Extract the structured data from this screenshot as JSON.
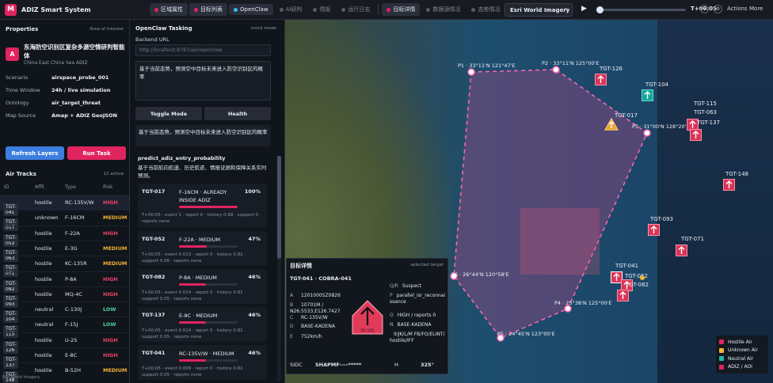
{
  "app": {
    "logo": "M",
    "title": "ADIZ Smart System"
  },
  "tabs": [
    {
      "label": "区域属性",
      "active": true
    },
    {
      "label": "目标列表",
      "active": true
    },
    {
      "label": "OpenClaw",
      "active": true
    },
    {
      "label": "AI研判",
      "active": false
    },
    {
      "label": "情报",
      "active": false
    },
    {
      "label": "运行日志",
      "active": false
    },
    {
      "label": "目标详情",
      "active": true
    },
    {
      "label": "数据源情况",
      "active": false
    },
    {
      "label": "态势情况",
      "active": false
    }
  ],
  "toolbar": {
    "imagery": "Esri World Imagery",
    "time": "T+00:05",
    "actions": "Actions",
    "more": "More",
    "progress": 0.03
  },
  "properties": {
    "title": "Properties",
    "subtitle": "Area of Interest",
    "zone_badge": "A",
    "zone_title": "东海防空识别区复杂多源空情研判智能体",
    "zone_subtitle": "China East China Sea ADIZ",
    "rows": [
      {
        "key": "Scenario",
        "value": "airspace_probe_001"
      },
      {
        "key": "Time Window",
        "value": "24h / live simulation"
      },
      {
        "key": "Ontology",
        "value": "air_target_threat"
      },
      {
        "key": "Map Source",
        "value": "Amap + ADIZ GeoJSON"
      }
    ],
    "refresh_label": "Refresh Layers",
    "run_label": "Run Task"
  },
  "tracks": {
    "title": "Air Tracks",
    "count": "12 active",
    "headers": [
      "ID",
      "Affil.",
      "Type",
      "Risk"
    ],
    "rows": [
      {
        "id": "TGT-041",
        "affil": "hostile",
        "type": "RC-135V/W",
        "risk": "HIGH"
      },
      {
        "id": "TGT-017",
        "affil": "unknown",
        "type": "F-16CM",
        "risk": "MEDIUM"
      },
      {
        "id": "TGT-052",
        "affil": "hostile",
        "type": "F-22A",
        "risk": "HIGH"
      },
      {
        "id": "TGT-063",
        "affil": "hostile",
        "type": "E-3G",
        "risk": "MEDIUM"
      },
      {
        "id": "TGT-071",
        "affil": "hostile",
        "type": "KC-135R",
        "risk": "MEDIUM"
      },
      {
        "id": "TGT-082",
        "affil": "hostile",
        "type": "P-8A",
        "risk": "HIGH"
      },
      {
        "id": "TGT-093",
        "affil": "hostile",
        "type": "MQ-4C",
        "risk": "HIGH"
      },
      {
        "id": "TGT-104",
        "affil": "neutral",
        "type": "C-130J",
        "risk": "LOW"
      },
      {
        "id": "TGT-115",
        "affil": "neutral",
        "type": "F-15J",
        "risk": "LOW"
      },
      {
        "id": "TGT-126",
        "affil": "hostile",
        "type": "U-2S",
        "risk": "HIGH"
      },
      {
        "id": "TGT-137",
        "affil": "hostile",
        "type": "E-8C",
        "risk": "HIGH"
      },
      {
        "id": "TGT-148",
        "affil": "hostile",
        "type": "B-52H",
        "risk": "MEDIUM"
      }
    ]
  },
  "tasking": {
    "title": "OpenClaw Tasking",
    "mode": "mock mode",
    "backend_label": "Backend URL",
    "backend_placeholder": "http://localhost:8787/api/openclaw",
    "prompt": "基于当前态势，预测空中目标未来进入防空识别区的概率",
    "toggle_label": "Toggle Mode",
    "health_label": "Health",
    "echo": "基于当前态势，预测空中目标未来进入防空识别区的概率",
    "task_name": "predict_adiz_entry_probability",
    "task_desc": "基于当前航向航速、历史航迹、情报证据和保障关系实时预测。",
    "cards": [
      {
        "id": "TGT-017",
        "desc": "F-16CM · ALREADY INSIDE ADIZ",
        "pct": "100%",
        "value": 1.0,
        "meta": "T+00:05 · event 1 · report 0 · history 0.68 · support 0 · reports none"
      },
      {
        "id": "TGT-052",
        "desc": "F-22A · MEDIUM",
        "pct": "47%",
        "value": 0.47,
        "meta": "T+00:05 · event 0.013 · report 0 · history 0.82 · support 0.06 · reports none"
      },
      {
        "id": "TGT-082",
        "desc": "P-8A · MEDIUM",
        "pct": "46%",
        "value": 0.46,
        "meta": "T+00:05 · event 0.014 · report 0 · history 0.82 · support 0.05 · reports none"
      },
      {
        "id": "TGT-137",
        "desc": "E-8C · MEDIUM",
        "pct": "46%",
        "value": 0.46,
        "meta": "T+00:05 · event 0.014 · report 0 · history 0.82 · support 0.05 · reports none"
      },
      {
        "id": "TGT-041",
        "desc": "RC-135V/W · MEDIUM",
        "pct": "46%",
        "value": 0.46,
        "meta": "T+00:05 · event 0.009 · report 0 · history 0.82 · support 0.05 · reports none"
      }
    ]
  },
  "detail": {
    "title": "目标详情",
    "selected": "selected target",
    "subtitle": "TGT-041 · COBRA-041",
    "left": [
      {
        "k": "A",
        "v": "12010005Z0826"
      },
      {
        "k": "B",
        "v": "10701M / N26.5533,E126.7427"
      },
      {
        "k": "C",
        "v": "RC-135V/W"
      },
      {
        "k": "D",
        "v": "BASE-KADENA"
      },
      {
        "k": "E",
        "v": "752km/h"
      }
    ],
    "right": [
      {
        "k": "Q/R",
        "v": "Suspect"
      },
      {
        "k": "P",
        "v": "parallel_isr_reconnaissance"
      },
      {
        "k": "O",
        "v": "HIGH / reports 0"
      },
      {
        "k": "N",
        "v": "BASE-KADENA"
      },
      {
        "k": "",
        "v": "II/JK/L/M FB/FO/ELINT/hostile/IFF"
      }
    ],
    "symbol_label": "RC-135",
    "sidc_label": "SIDC",
    "sidc": "SHAPMF----*****",
    "h_label": "H",
    "h_value": "325°"
  },
  "legend": [
    {
      "label": "Hostile Air",
      "color": "#e0245e"
    },
    {
      "label": "Unknown Air",
      "color": "#f2b233"
    },
    {
      "label": "Neutral Air",
      "color": "#1fb8a6"
    },
    {
      "label": "ADIZ / AOI",
      "color": "#e0245e"
    }
  ],
  "map": {
    "points": [
      {
        "label": "P1 · 33°11'N 121°47'E"
      },
      {
        "label": "P2 · 33°11'N 125°00'E"
      },
      {
        "label": "P3 · 31°00'N 128°20'E"
      },
      {
        "label": "P4 · 25°38'N 125°00'E"
      },
      {
        "label": "P5 · 24°45'N 123°00'E"
      },
      {
        "label": "P6 · 26°44'N 120°58'E"
      }
    ],
    "targets": [
      {
        "label": "TGT-126",
        "affil": "hostile"
      },
      {
        "label": "TGT-104",
        "affil": "neutral"
      },
      {
        "label": "TGT-115",
        "affil": "hostile"
      },
      {
        "label": "TGT-063",
        "affil": "hostile"
      },
      {
        "label": "TGT-137",
        "affil": "hostile"
      },
      {
        "label": "TGT-017",
        "affil": "unknown"
      },
      {
        "label": "TGT-148",
        "affil": "hostile"
      },
      {
        "label": "TGT-093",
        "affil": "hostile"
      },
      {
        "label": "TGT-071",
        "affil": "hostile"
      },
      {
        "label": "TGT-041",
        "affil": "hostile"
      },
      {
        "label": "TGT-052",
        "affil": "hostile"
      },
      {
        "label": "TGT-082",
        "affil": "hostile"
      }
    ]
  },
  "footnote": "Esri World Imagery"
}
